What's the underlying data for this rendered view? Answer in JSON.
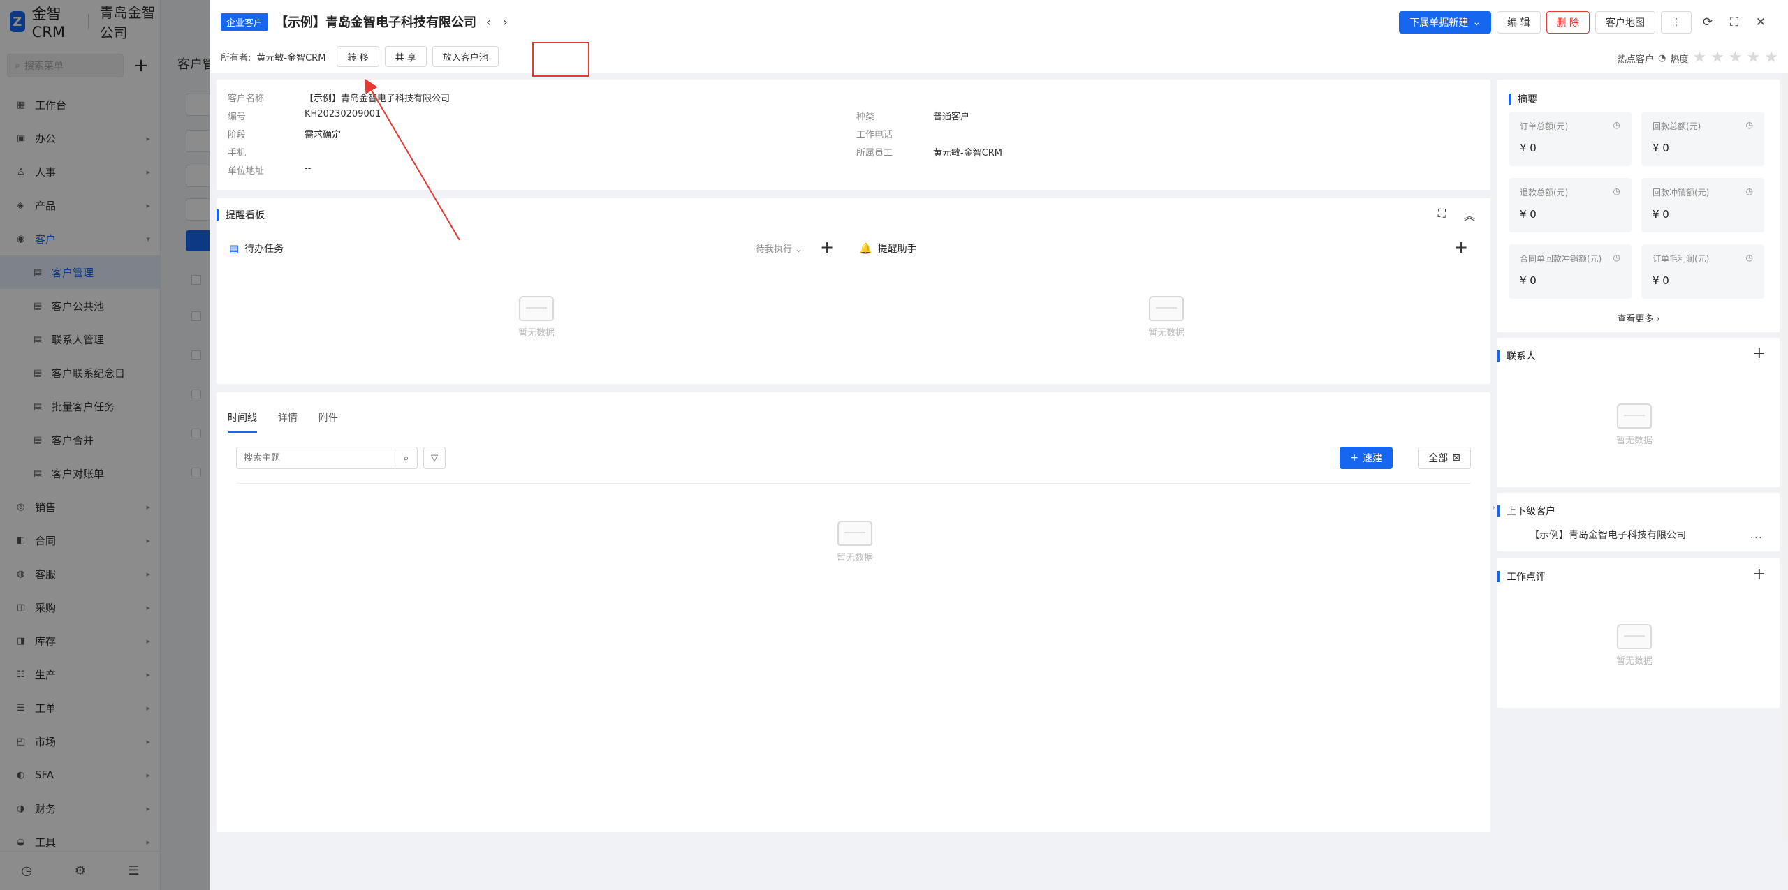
{
  "brand": {
    "logo": "Z",
    "name": "金智CRM",
    "company": "青岛金智公司"
  },
  "sidebar": {
    "search_placeholder": "搜索菜单",
    "items": [
      {
        "icon": "▦",
        "label": "工作台",
        "arrow": ""
      },
      {
        "icon": "▣",
        "label": "办公",
        "arrow": "▸"
      },
      {
        "icon": "♙",
        "label": "人事",
        "arrow": "▸"
      },
      {
        "icon": "◈",
        "label": "产品",
        "arrow": "▸"
      },
      {
        "icon": "◉",
        "label": "客户",
        "arrow": "▾"
      },
      {
        "icon": "▤",
        "label": "客户管理",
        "arrow": ""
      },
      {
        "icon": "▤",
        "label": "客户公共池",
        "arrow": ""
      },
      {
        "icon": "▤",
        "label": "联系人管理",
        "arrow": ""
      },
      {
        "icon": "▤",
        "label": "客户联系纪念日",
        "arrow": ""
      },
      {
        "icon": "▤",
        "label": "批量客户任务",
        "arrow": ""
      },
      {
        "icon": "▤",
        "label": "客户合并",
        "arrow": ""
      },
      {
        "icon": "▤",
        "label": "客户对账单",
        "arrow": ""
      },
      {
        "icon": "◎",
        "label": "销售",
        "arrow": "▸"
      },
      {
        "icon": "◧",
        "label": "合同",
        "arrow": "▸"
      },
      {
        "icon": "◍",
        "label": "客服",
        "arrow": "▸"
      },
      {
        "icon": "◫",
        "label": "采购",
        "arrow": "▸"
      },
      {
        "icon": "◨",
        "label": "库存",
        "arrow": "▸"
      },
      {
        "icon": "☷",
        "label": "生产",
        "arrow": "▸"
      },
      {
        "icon": "☰",
        "label": "工单",
        "arrow": "▸"
      },
      {
        "icon": "◰",
        "label": "市场",
        "arrow": "▸"
      },
      {
        "icon": "◐",
        "label": "SFA",
        "arrow": "▸"
      },
      {
        "icon": "◑",
        "label": "财务",
        "arrow": "▸"
      },
      {
        "icon": "◒",
        "label": "工具",
        "arrow": "▸"
      }
    ],
    "footer": {
      "history": "◷",
      "settings": "⚙",
      "menu": "☰"
    }
  },
  "main_bg": {
    "title": "客户管"
  },
  "drawer": {
    "badge": "企业客户",
    "title": "【示例】青岛金智电子科技有限公司",
    "prev": "‹",
    "next": "›",
    "actions": {
      "new_sub": "下属单据新建",
      "edit": "编 辑",
      "delete": "删 除",
      "map": "客户地图",
      "more": "⋮",
      "refresh": "⟳",
      "fullscreen": "⛶",
      "close": "✕"
    },
    "owner_label": "所有者:",
    "owner_value": "黄元敏-金智CRM",
    "owner_actions": {
      "transfer": "转 移",
      "share": "共 享",
      "to_pool": "放入客户池"
    },
    "hot": {
      "label": "热点客户",
      "heat_label": "热度",
      "stars_filled": 0,
      "stars_total": 5
    }
  },
  "info": {
    "left": [
      {
        "key": "客户名称",
        "value": "【示例】青岛金智电子科技有限公司"
      },
      {
        "key": "编号",
        "value": "KH20230209001"
      },
      {
        "key": "阶段",
        "value": "需求确定"
      },
      {
        "key": "手机",
        "value": ""
      },
      {
        "key": "单位地址",
        "value": "--"
      }
    ],
    "right": [
      {
        "key": "种类",
        "value": "普通客户"
      },
      {
        "key": "工作电话",
        "value": ""
      },
      {
        "key": "所属员工",
        "value": "黄元敏-金智CRM"
      }
    ]
  },
  "remind": {
    "title": "提醒看板",
    "todo_title": "待办任务",
    "todo_filter": "待我执行",
    "helper_title": "提醒助手",
    "empty": "暂无数据"
  },
  "timeline": {
    "tabs": [
      "时间线",
      "详情",
      "附件"
    ],
    "search_placeholder": "搜索主题",
    "new_label": "速建",
    "all_label": "全部",
    "empty": "暂无数据"
  },
  "summary": {
    "title": "摘要",
    "cards": [
      {
        "label": "订单总额(元)",
        "value": "¥ 0"
      },
      {
        "label": "回款总额(元)",
        "value": "¥ 0"
      },
      {
        "label": "退款总额(元)",
        "value": "¥ 0"
      },
      {
        "label": "回款冲销额(元)",
        "value": "¥ 0"
      },
      {
        "label": "合同单回款冲销额(元)",
        "value": "¥ 0"
      },
      {
        "label": "订单毛利润(元)",
        "value": "¥ 0"
      }
    ],
    "see_more": "查看更多 ›"
  },
  "contacts": {
    "title": "联系人",
    "empty": "暂无数据"
  },
  "parent": {
    "title": "上下级客户",
    "item": "【示例】青岛金智电子科技有限公司",
    "more": "..."
  },
  "review": {
    "title": "工作点评",
    "empty": "暂无数据"
  },
  "colors": {
    "accent": "#1766f0",
    "danger": "#e53935",
    "annotation": "#e53935"
  }
}
